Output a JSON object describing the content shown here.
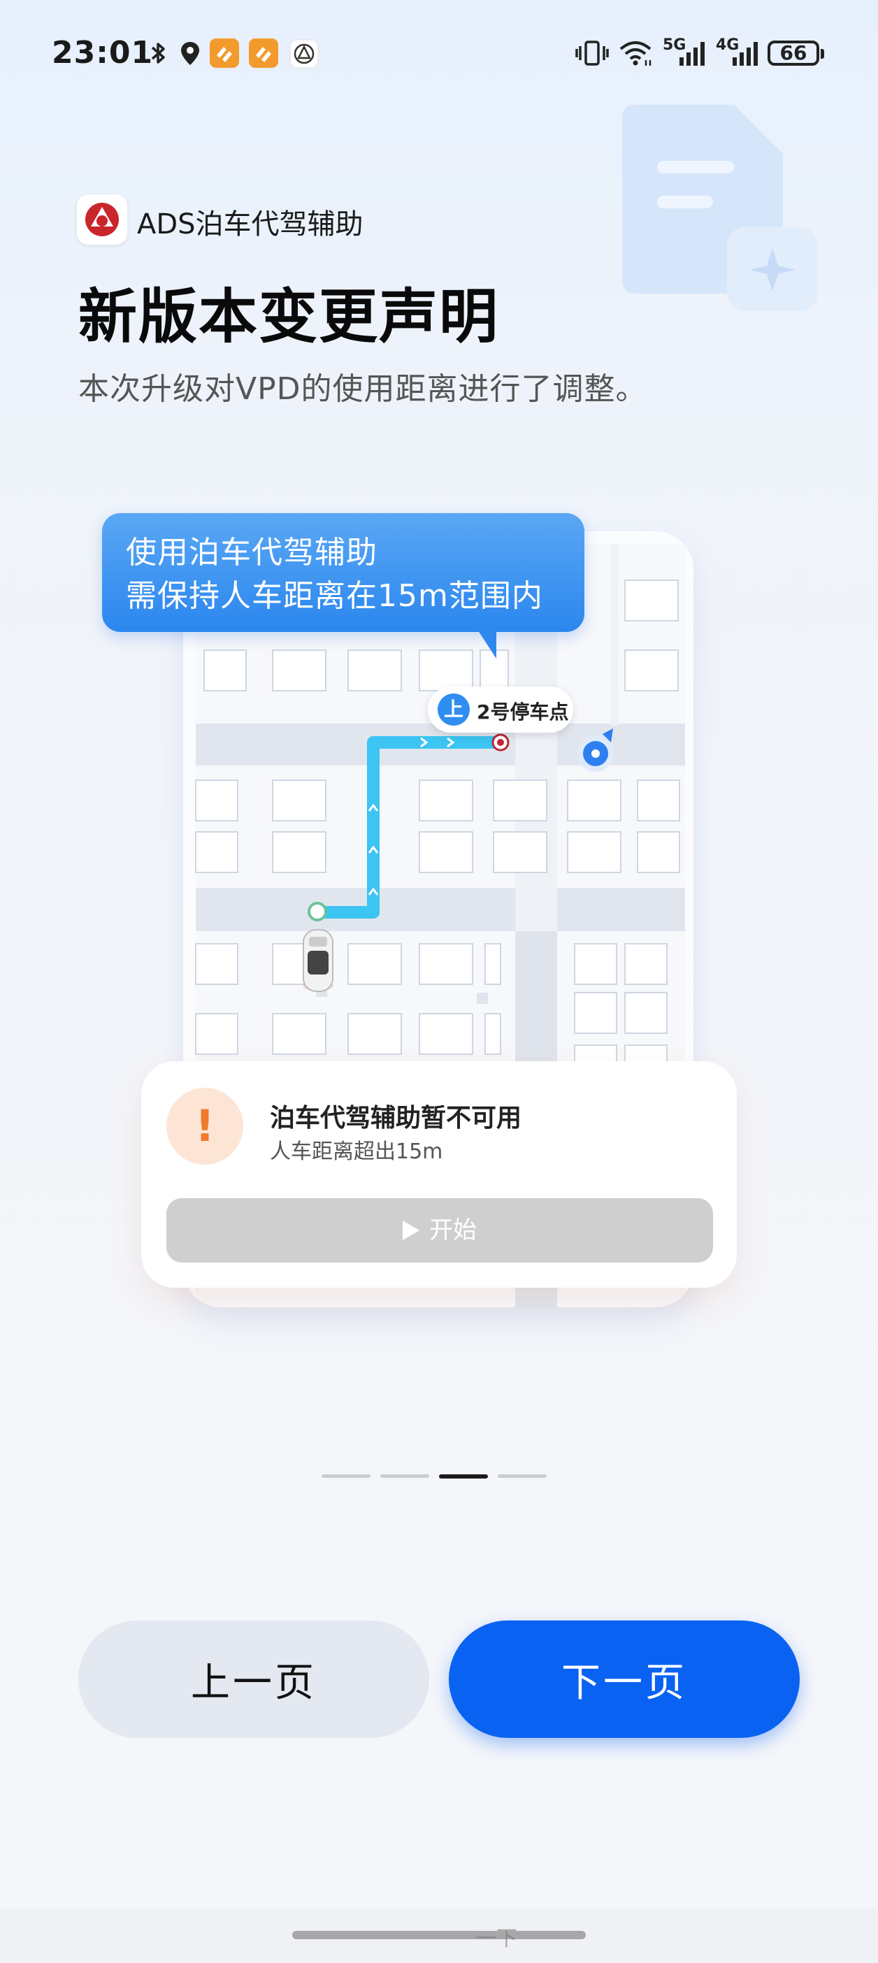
{
  "status_bar": {
    "time": "23:01",
    "icons_left": [
      "bluetooth-icon",
      "location-icon",
      "app-notification-icon",
      "app-notification-icon",
      "ads-app-icon"
    ],
    "icons_right": [
      "vibrate-icon",
      "wifi-icon",
      "signal-5g-icon",
      "signal-4g-icon"
    ],
    "network_5g": "5G",
    "network_4g": "4G",
    "battery": "66"
  },
  "header": {
    "app_name": "ADS泊车代驾辅助",
    "title": "新版本变更声明",
    "subtitle": "本次升级对VPD的使用距离进行了调整。"
  },
  "illustration": {
    "bubble_line1": "使用泊车代驾辅助",
    "bubble_line2": "需保持人车距离在15m范围内",
    "stop_icon_char": "上",
    "stop_label": "2号停车点"
  },
  "warning_card": {
    "icon_char": "!",
    "title": "泊车代驾辅助暂不可用",
    "subtitle": "人车距离超出15m",
    "start_label": "开始"
  },
  "pager": {
    "total": 4,
    "active_index": 2
  },
  "buttons": {
    "prev_label": "上一页",
    "next_label": "下一页"
  },
  "bottom": {
    "faint_text": "一下"
  },
  "colors": {
    "primary": "#0a62f2",
    "bubble": "#3a93f0",
    "warning": "#ef7a2d",
    "route": "#3cc4f3"
  }
}
